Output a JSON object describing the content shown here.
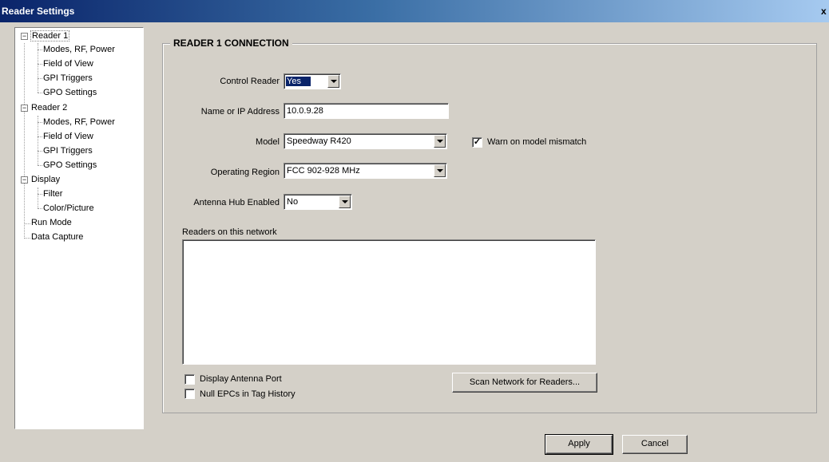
{
  "window": {
    "title": "Reader Settings",
    "close_label": "x"
  },
  "tree": {
    "items": [
      {
        "label": "Reader 1",
        "expander": "−"
      },
      {
        "label": "Modes, RF, Power"
      },
      {
        "label": "Field of View"
      },
      {
        "label": "GPI Triggers"
      },
      {
        "label": "GPO Settings"
      },
      {
        "label": "Reader 2",
        "expander": "−"
      },
      {
        "label": "Modes, RF, Power"
      },
      {
        "label": "Field of View"
      },
      {
        "label": "GPI Triggers"
      },
      {
        "label": "GPO Settings"
      },
      {
        "label": "Display",
        "expander": "−"
      },
      {
        "label": "Filter"
      },
      {
        "label": "Color/Picture"
      },
      {
        "label": "Run Mode"
      },
      {
        "label": "Data Capture"
      }
    ],
    "selected": "Reader 1"
  },
  "connection": {
    "group_title": "READER 1 CONNECTION",
    "control_reader_label": "Control Reader",
    "control_reader_value": "Yes",
    "name_ip_label": "Name or IP Address",
    "name_ip_value": "10.0.9.28",
    "model_label": "Model",
    "model_value": "Speedway R420",
    "warn_mismatch_label": "Warn on model mismatch",
    "warn_mismatch_checked": true,
    "region_label": "Operating Region",
    "region_value": "FCC 902-928 MHz",
    "hub_label": "Antenna Hub Enabled",
    "hub_value": "No",
    "readers_list_label": "Readers on this network",
    "readers_list": [],
    "display_port_label": "Display Antenna Port",
    "display_port_checked": false,
    "null_epcs_label": "Null EPCs in Tag History",
    "null_epcs_checked": false,
    "scan_button_label": "Scan Network for Readers..."
  },
  "footer": {
    "apply_label": "Apply",
    "cancel_label": "Cancel"
  },
  "icons": {
    "checked_mark": "✓",
    "dropdown": "chevron-down-icon"
  }
}
